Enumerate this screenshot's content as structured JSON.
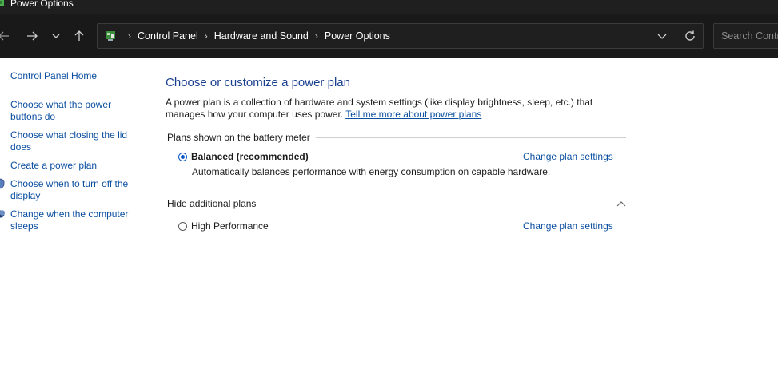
{
  "window": {
    "title": "Power Options"
  },
  "toolbar": {
    "icons": [
      "back-arrow-icon",
      "forward-arrow-icon",
      "chevron-down-icon",
      "up-arrow-icon",
      "refresh-icon"
    ]
  },
  "address": {
    "crumbs": [
      "Control Panel",
      "Hardware and Sound",
      "Power Options"
    ],
    "separator": "›"
  },
  "search": {
    "placeholder": "Search Control Panel"
  },
  "sidebar": {
    "items": [
      {
        "label": "Control Panel Home"
      },
      {
        "label": "Choose what the power buttons do"
      },
      {
        "label": "Choose what closing the lid does"
      },
      {
        "label": "Create a power plan"
      },
      {
        "label": "Choose when to turn off the display",
        "icon": "shield-icon"
      },
      {
        "label": "Change when the computer sleeps",
        "icon": "moon-icon"
      }
    ]
  },
  "main": {
    "heading": "Choose or customize a power plan",
    "description": "A power plan is a collection of hardware and system settings (like display brightness, sleep, etc.) that manages how your computer uses power.",
    "learn_more": "Tell me more about power plans",
    "battery_section": "Plans shown on the battery meter",
    "plans": [
      {
        "name": "Balanced (recommended)",
        "selected": true,
        "description": "Automatically balances performance with energy consumption on capable hardware.",
        "link": "Change plan settings"
      },
      {
        "name": "High Performance",
        "selected": false,
        "link": "Change plan settings"
      }
    ],
    "additional_section": "Hide additional plans"
  },
  "colors": {
    "link": "#0b4fa0",
    "heading": "#1a3f8f",
    "radio": "#0a57c2",
    "chrome": "#191919"
  }
}
